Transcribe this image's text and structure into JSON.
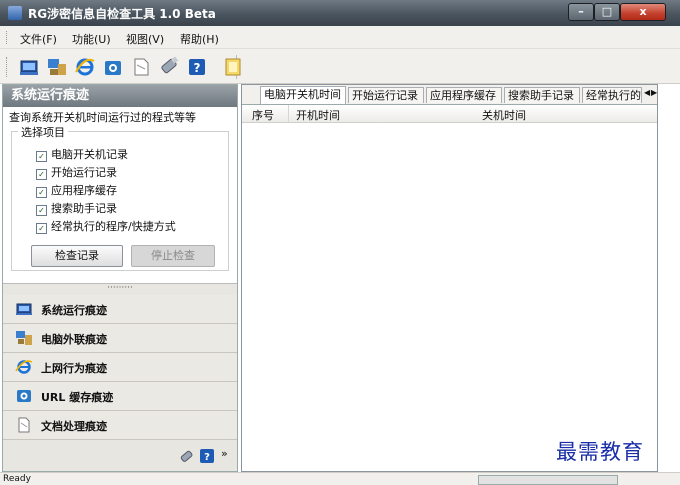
{
  "window": {
    "title": "RG涉密信息自检查工具 1.0 Beta",
    "minimize_label": "–",
    "maximize_label": "□",
    "close_label": "x"
  },
  "menubar": {
    "items": [
      "文件(F)",
      "功能(U)",
      "视图(V)",
      "帮助(H)"
    ]
  },
  "toolbar": {
    "icons": [
      "system-trace-icon",
      "external-device-icon",
      "internet-explorer-icon",
      "url-cache-icon",
      "document-icon",
      "usb-drive-icon",
      "help-icon",
      "notepad-icon"
    ]
  },
  "left_panel": {
    "title": "系统运行痕迹",
    "description": "查询系统开关机时间运行过的程式等等",
    "group_label": "选择项目",
    "checkboxes": [
      {
        "label": "电脑开关机记录",
        "checked": true
      },
      {
        "label": "开始运行记录",
        "checked": true
      },
      {
        "label": "应用程序缓存",
        "checked": true
      },
      {
        "label": "搜索助手记录",
        "checked": true
      },
      {
        "label": "经常执行的程序/快捷方式",
        "checked": true
      }
    ],
    "check_button": "检查记录",
    "stop_button": "停止检查",
    "splitter_text": "·········",
    "nav": [
      {
        "label": "系统运行痕迹",
        "icon": "system-trace-icon"
      },
      {
        "label": "电脑外联痕迹",
        "icon": "external-device-icon"
      },
      {
        "label": "上网行为痕迹",
        "icon": "internet-explorer-icon"
      },
      {
        "label": "URL 缓存痕迹",
        "icon": "url-cache-icon"
      },
      {
        "label": "文档处理痕迹",
        "icon": "document-icon"
      }
    ],
    "footer_chevron": "»"
  },
  "right_panel": {
    "tabs": [
      "电脑开关机时间",
      "开始运行记录",
      "应用程序缓存",
      "搜索助手记录",
      "经常执行的"
    ],
    "tab_scroll_left": "◀",
    "tab_scroll_right": "▶",
    "columns": [
      "序号",
      "开机时间",
      "关机时间"
    ]
  },
  "statusbar": {
    "text": "Ready"
  },
  "watermark": "最需教育",
  "colors": {
    "title_bar": "#4a545e",
    "close_button": "#c4402c",
    "panel_header": "#7b848b",
    "watermark": "#1a2ea8"
  }
}
